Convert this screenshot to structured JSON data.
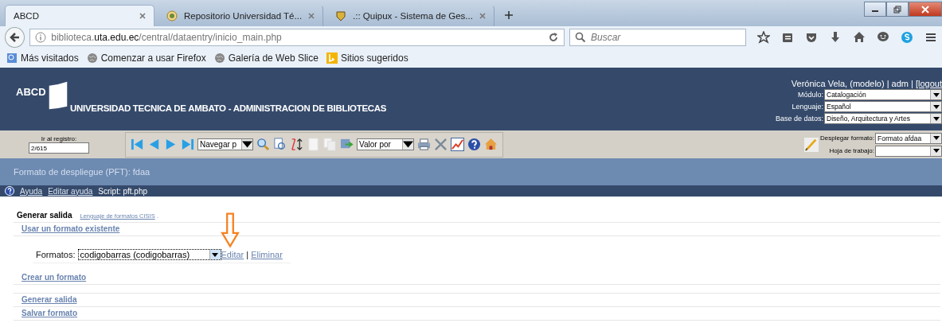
{
  "browser": {
    "tabs": [
      {
        "title": "ABCD",
        "selected": true
      },
      {
        "title": "Repositorio Universidad Té...",
        "selected": false
      },
      {
        "title": ".:: Quipux - Sistema de Ges...",
        "selected": false
      }
    ],
    "url": {
      "prefix": "biblioteca.",
      "domain": "uta.edu.ec",
      "path": "/central/dataentry/inicio_main.php"
    },
    "search": {
      "placeholder": "Buscar"
    },
    "bookmarks": [
      "Más visitados",
      "Comenzar a usar Firefox",
      "Galería de Web Slice",
      "Sitios sugeridos"
    ]
  },
  "header": {
    "logo": "ABCD",
    "title": "UNIVERSIDAD TECNICA DE AMBATO - ADMINISTRACION DE BIBLIOTECAS",
    "user": "Verónica Vela, (modelo) | adm | ",
    "logout": "[logout",
    "selects": [
      {
        "label": "Módulo:",
        "value": "Catalogación"
      },
      {
        "label": "Lenguaje:",
        "value": "Español"
      },
      {
        "label": "Base de datos:",
        "value": "Diseño, Arquitectura y Artes"
      }
    ]
  },
  "toolbar": {
    "record_label": "Ir al registro:",
    "record_value": "2/615",
    "navigate": "Navegar p",
    "value_by": "Valor por",
    "format_label": "Desplegar formato:",
    "format_value": "Formato afdaa",
    "worksheet_label": "Hoja de trabajo:"
  },
  "page_title": "Formato de despliegue (PFT): fdaa",
  "help": {
    "help_link": "Ayuda",
    "edit_help_link": "Editar ayuda",
    "script": "Script: pft.php"
  },
  "content": {
    "heading": "Generar salida",
    "cisis_link": "Lenguaje de formatos CISIS",
    "cisis_after": ".",
    "use_existing": "Usar un formato existente",
    "formats_label": "Formatos:",
    "formats_value": "codigobarras (codigobarras)",
    "edit": "Editar",
    "separator": "|",
    "delete": "Eliminar",
    "create": "Crear un formato",
    "generate": "Generar salida",
    "save": "Salvar formato"
  }
}
